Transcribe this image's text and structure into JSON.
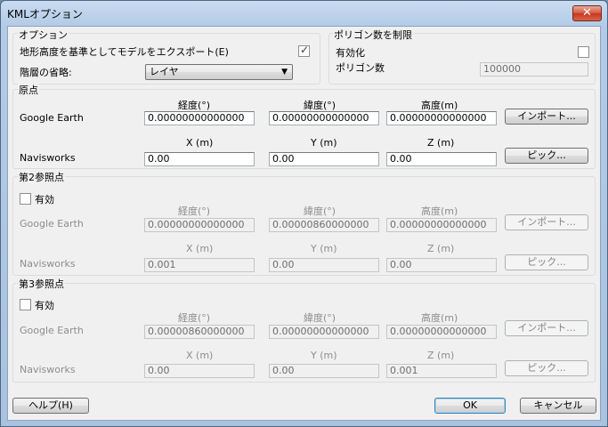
{
  "window": {
    "title": "KMLオプション",
    "close_glyph": "✕"
  },
  "options_group": {
    "label": "オプション",
    "export_label": "地形高度を基準としてモデルをエクスポート(E)",
    "export_checked": true,
    "hierarchy_label": "階層の省略:",
    "hierarchy_value": "レイヤ",
    "check_glyph": "✓",
    "dropdown_glyph": "▼"
  },
  "polygon_group": {
    "label": "ポリゴン数を制限",
    "enable_label": "有効化",
    "enable_checked": false,
    "count_label": "ポリゴン数",
    "count_value": "100000"
  },
  "origin": {
    "label": "原点",
    "col_lon": "経度(°)",
    "col_lat": "緯度(°)",
    "col_alt": "高度(m)",
    "row_ge": "Google Earth",
    "ge_lon": "0.00000000000000",
    "ge_lat": "0.00000000000000",
    "ge_alt": "0.00000000000000",
    "import_button": "インポート...",
    "col_x": "X (m)",
    "col_y": "Y (m)",
    "col_z": "Z (m)",
    "row_nw": "Navisworks",
    "nw_x": "0.00",
    "nw_y": "0.00",
    "nw_z": "0.00",
    "pick_button": "ピック..."
  },
  "ref2": {
    "label": "第2参照点",
    "enable_label": "有効",
    "enable_checked": false,
    "col_lon": "経度(°)",
    "col_lat": "緯度(°)",
    "col_alt": "高度(m)",
    "row_ge": "Google Earth",
    "ge_lon": "0.00000000000000",
    "ge_lat": "0.00000860000000",
    "ge_alt": "0.00000000000000",
    "import_button": "インポート...",
    "col_x": "X (m)",
    "col_y": "Y (m)",
    "col_z": "Z (m)",
    "row_nw": "Navisworks",
    "nw_x": "0.001",
    "nw_y": "0.00",
    "nw_z": "0.00",
    "pick_button": "ピック..."
  },
  "ref3": {
    "label": "第3参照点",
    "enable_label": "有効",
    "enable_checked": false,
    "col_lon": "経度(°)",
    "col_lat": "緯度(°)",
    "col_alt": "高度(m)",
    "row_ge": "Google Earth",
    "ge_lon": "0.00000860000000",
    "ge_lat": "0.00000000000000",
    "ge_alt": "0.00000000000000",
    "import_button": "インポート...",
    "col_x": "X (m)",
    "col_y": "Y (m)",
    "col_z": "Z (m)",
    "row_nw": "Navisworks",
    "nw_x": "0.00",
    "nw_y": "0.00",
    "nw_z": "0.001",
    "pick_button": "ピック..."
  },
  "footer": {
    "help_button": "ヘルプ(H)",
    "ok_button": "OK",
    "cancel_button": "キャンセル"
  }
}
